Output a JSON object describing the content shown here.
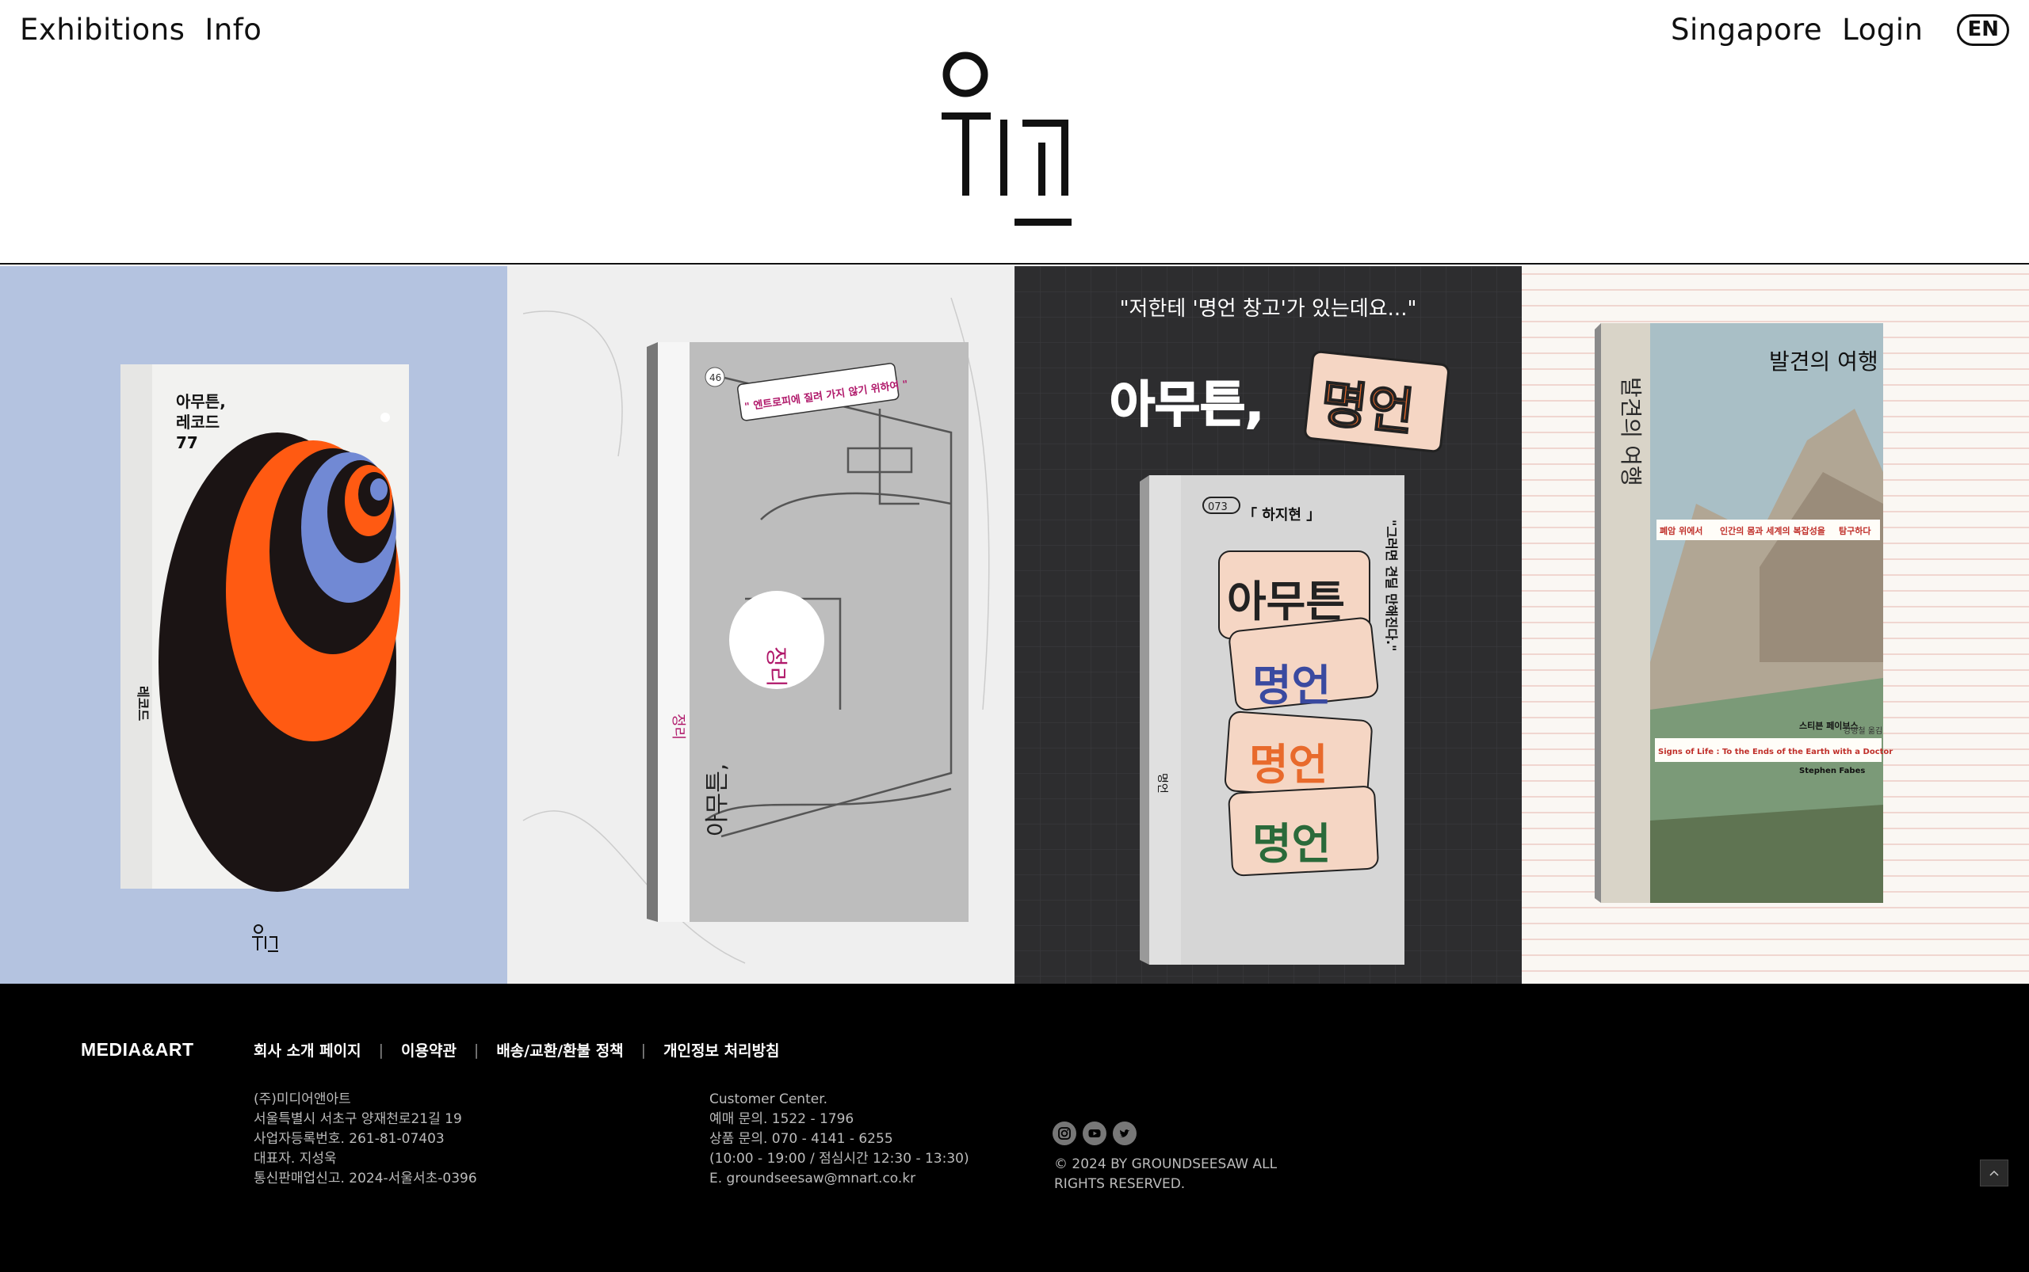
{
  "nav": {
    "left": [
      "Exhibitions",
      "Info"
    ],
    "right": [
      "Singapore",
      "Login"
    ],
    "lang": "EN"
  },
  "books": [
    {
      "title": "아무튼, 레코드 77",
      "spine": "레코드",
      "logo_mark": "위고",
      "color_bg": "#b4c3e0"
    },
    {
      "title": "정리",
      "quote": "\" 엔트로피에 질려 가지 않기 위하여 \"",
      "series_no": "46",
      "cover_title": "아무튼,",
      "color_bg": "#efefef"
    },
    {
      "headline": "\"저한테 '명언 창고'가 있는데요...\"",
      "big_a": "아무튼,",
      "big_b": "명언",
      "number": "073",
      "author": "「 하지현 」",
      "quote": "\"그러면 견딜 만해진다.\"",
      "spine": "명언",
      "cal_words": [
        "아무튼",
        "명언",
        "명언",
        "명언"
      ],
      "color_bg": "#2d2d2f"
    },
    {
      "title": "발견의 여행",
      "spine_title": "발견의 여행",
      "tagline_a": "폐암 위에서",
      "tagline_b": "인간의 몸과 세계의 복잡성을",
      "tagline_c": "탐구하다",
      "en_title": "Signs of Life : To the Ends of the Earth with a Doctor",
      "author_ko": "스티븐 페이브스",
      "author_en": "Stephen Fabes",
      "translator": "강병철 옮김",
      "color_bg": "#faf7f3"
    }
  ],
  "footer": {
    "brand": "MEDIA&ART",
    "links": [
      "회사 소개 페이지",
      "이용약관",
      "배송/교환/환불 정책",
      "개인정보 처리방침"
    ],
    "company": [
      "(주)미디어앤아트",
      "서울특별시 서초구 양재천로21길 19",
      "사업자등록번호. 261-81-07403",
      "대표자. 지성욱",
      "통신판매업신고. 2024-서울서초-0396"
    ],
    "customer": [
      "Customer Center.",
      "예매 문의. 1522 - 1796",
      "상품 문의. 070 - 4141 - 6255",
      "(10:00 - 19:00 / 점심시간 12:30 - 13:30)",
      "E. groundseesaw@mnart.co.kr"
    ],
    "copyright_1": "© 2024 BY GROUNDSEESAW ALL",
    "copyright_2": "RIGHTS RESERVED.",
    "social": [
      "instagram-icon",
      "youtube-icon",
      "twitter-icon"
    ]
  }
}
